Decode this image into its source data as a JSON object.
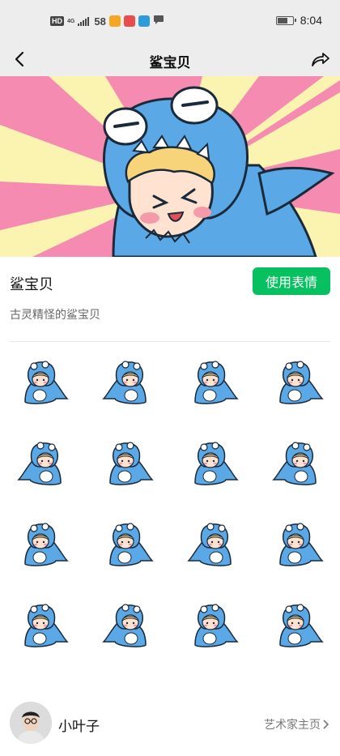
{
  "status_bar": {
    "hd": "HD",
    "network": "4G",
    "carrier_app": "58",
    "time": "8:04",
    "battery_level": 0.6
  },
  "nav": {
    "title": "鲨宝贝",
    "back_icon": "chevron-left-icon",
    "share_icon": "share-arrow-icon"
  },
  "pack": {
    "name": "鲨宝贝",
    "use_button": "使用表情",
    "description": "古灵精怪的鲨宝贝",
    "sticker_count": 16
  },
  "artist": {
    "name": "小叶子",
    "link_label": "艺术家主页",
    "link_icon": "chevron-right-icon"
  },
  "colors": {
    "accent": "#07c160",
    "shark_blue": "#5aa9e6",
    "banner_pink": "#f58bb0",
    "banner_yellow": "#fbf3b0"
  }
}
